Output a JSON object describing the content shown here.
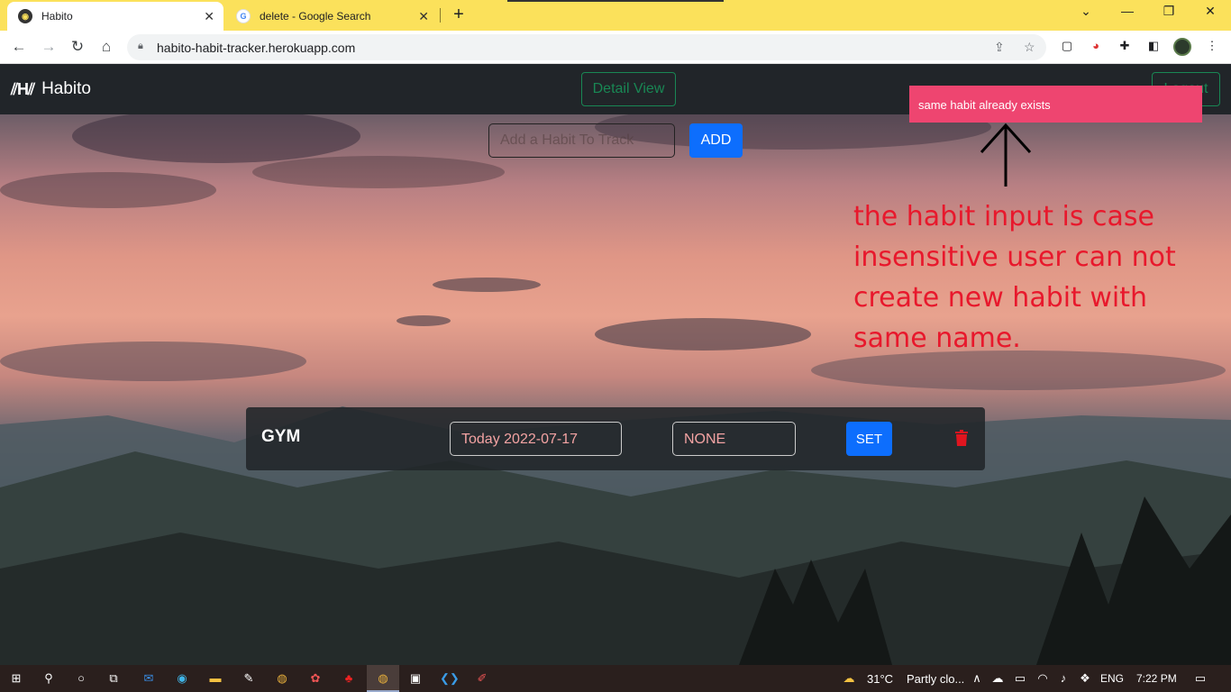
{
  "browser": {
    "tabs": [
      {
        "title": "Habito",
        "favicon": "habito-favicon-icon",
        "active": true
      },
      {
        "title": "delete - Google Search",
        "favicon": "google-favicon-icon",
        "active": false
      }
    ],
    "url": "habito-habit-tracker.herokuapp.com"
  },
  "app": {
    "brand": "Habito",
    "detail_view_label": "Detail View",
    "right_button_label": "Logout",
    "toast_message": "same habit already exists",
    "input_placeholder": "Add a Habit To Track",
    "add_label": "ADD",
    "annotation_text": "the habit input is case insensitive user can not create new habit with same name.",
    "habit": {
      "name": "GYM",
      "date": "Today 2022-07-17",
      "status": "NONE",
      "set_label": "SET"
    }
  },
  "taskbar": {
    "weather_temp": "31°C",
    "weather_desc": "Partly clo...",
    "language": "ENG",
    "time": "7:22 PM"
  },
  "colors": {
    "toast": "#ee4570",
    "primary": "#0d6efd",
    "success": "#198754",
    "annotation": "#e8182c",
    "navbar": "#212529"
  }
}
